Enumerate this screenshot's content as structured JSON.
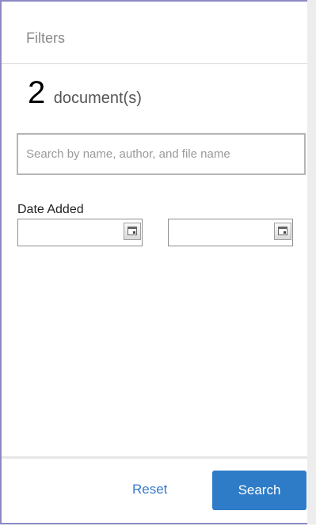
{
  "header": {
    "title": "Filters"
  },
  "summary": {
    "count": "2",
    "label": "document(s)"
  },
  "search": {
    "placeholder": "Search by name, author, and file name",
    "value": ""
  },
  "date_added": {
    "label": "Date Added",
    "from_value": "",
    "to_value": "",
    "icon": "calendar-icon"
  },
  "footer": {
    "reset_label": "Reset",
    "search_label": "Search"
  },
  "colors": {
    "panel_border": "#8c89c4",
    "primary_button": "#2e7cc7",
    "link": "#3a7ac9"
  }
}
